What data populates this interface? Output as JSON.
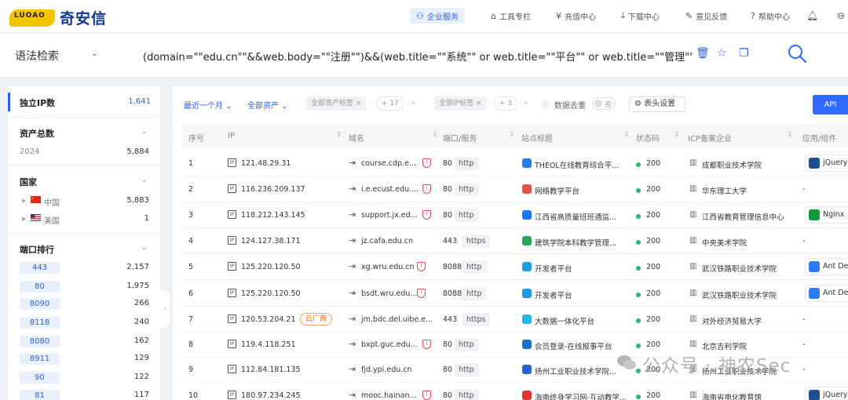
{
  "brand": {
    "logo_mark_text": "LUOAO",
    "name": "奇安信"
  },
  "nav": [
    {
      "label": "企业服务",
      "icon": "user-service-icon",
      "active": true
    },
    {
      "label": "工具专栏",
      "icon": "toolbox-icon"
    },
    {
      "label": "充值中心",
      "icon": "yen-icon"
    },
    {
      "label": "下载中心",
      "icon": "download-icon"
    },
    {
      "label": "意见反馈",
      "icon": "feedback-icon"
    },
    {
      "label": "帮助中心",
      "icon": "help-icon"
    }
  ],
  "search": {
    "mode_label": "语法检索",
    "query": "(domain=\"\"edu.cn\"\"&&web.body=\"\"注册\"\")&&(web.title=\"\"系统\"\" or web.title=\"\"平台\"\" or web.title=\"\"管理\"\" or web.title=\"\"后台\"\")"
  },
  "sidebar": {
    "unique_ip": {
      "label": "独立IP数",
      "value": "1,641"
    },
    "assets": {
      "label": "资产总数",
      "year": "2024",
      "count": "5,884"
    },
    "country": {
      "label": "国家",
      "items": [
        {
          "name": "中国",
          "count": "5,883"
        },
        {
          "name": "美国",
          "count": "1"
        }
      ]
    },
    "ports": {
      "label": "端口排行",
      "items": [
        {
          "port": "443",
          "count": "2,157"
        },
        {
          "port": "80",
          "count": "1,975"
        },
        {
          "port": "8090",
          "count": "266"
        },
        {
          "port": "8118",
          "count": "240"
        },
        {
          "port": "8080",
          "count": "162"
        },
        {
          "port": "8911",
          "count": "129"
        },
        {
          "port": "90",
          "count": "122"
        },
        {
          "port": "81",
          "count": "117"
        }
      ]
    }
  },
  "filters": {
    "time": "最近一个月",
    "assets": "全部资产",
    "asset_tag": "全部资产标签",
    "asset_tag_count": "+ 17",
    "ip_tag": "全部IP标签",
    "ip_tag_count": "+ 3",
    "dedupe_label": "数据去重",
    "dedupe_state": "否",
    "column_settings": "表头设置",
    "api": "API"
  },
  "table": {
    "headers": [
      "序号",
      "IP",
      "域名",
      "端口/服务",
      "站点标题",
      "状态码",
      "ICP备案企业",
      "应用/组件"
    ],
    "rows": [
      {
        "no": "1",
        "ip": "121.48.29.31",
        "domain": "course.cdp.e...",
        "shield": true,
        "port": "80",
        "proto": "http",
        "title": "THEOL在线教育综合平...",
        "icon_color": "#2a7de1",
        "status": "200",
        "icp": "成都职业技术学院",
        "component": "jQuery",
        "comp_color": "#1e4f8f"
      },
      {
        "no": "2",
        "ip": "116.236.209.137",
        "domain": "i.e.ecust.edu....",
        "shield": true,
        "port": "80",
        "proto": "http",
        "title": "网络教学平台",
        "icon_color": "#e2574c",
        "status": "200",
        "icp": "华东理工大学",
        "component": "-"
      },
      {
        "no": "3",
        "ip": "118.212.143.145",
        "domain": "support.jx.ed...",
        "shield": true,
        "port": "80",
        "proto": "http",
        "title": "江西省高质量班班通监...",
        "icon_color": "#1677ff",
        "status": "200",
        "icp": "江西省教育管理信息中心",
        "component": "Nginx",
        "comp_color": "#119a3c"
      },
      {
        "no": "4",
        "ip": "124.127.38.171",
        "domain": "jz.cafa.edu.cn",
        "shield": false,
        "port": "443",
        "proto": "https",
        "title": "建筑学院本科教学管理...",
        "icon_color": "#2aa65a",
        "status": "200",
        "icp": "中央美术学院",
        "component": "-"
      },
      {
        "no": "5",
        "ip": "125.220.120.50",
        "domain": "xg.wru.edu.cn",
        "shield": true,
        "port": "8088",
        "proto": "http",
        "title": "开发者平台",
        "icon_color": "#1f9bdc",
        "status": "200",
        "icp": "武汉铁路职业技术学院",
        "component": "Ant Des",
        "comp_color": "#2f7af5"
      },
      {
        "no": "6",
        "ip": "125.220.120.50",
        "domain": "bsdt.wru.edu...",
        "shield": true,
        "port": "8088",
        "proto": "http",
        "title": "开发者平台",
        "icon_color": "#1f9bdc",
        "status": "200",
        "icp": "武汉铁路职业技术学院",
        "component": "Ant Des",
        "comp_color": "#2f7af5"
      },
      {
        "no": "7",
        "ip": "120.53.204.21",
        "cloud": "云厂商",
        "domain": "jm.bdc.del.uibe.e...",
        "shield": false,
        "port": "443",
        "proto": "https",
        "title": "大数据一体化平台",
        "icon_color": "#2bb5e8",
        "status": "200",
        "icp": "对外经济贸易大学",
        "component": "-"
      },
      {
        "no": "8",
        "ip": "119.4.118.251",
        "domain": "bxpt.guc.edu...",
        "shield": true,
        "port": "80",
        "proto": "http",
        "title": "会员登录-在线报事平台",
        "icon_color": "#1a73c9",
        "status": "200",
        "icp": "北京吉利学院",
        "component": "-"
      },
      {
        "no": "9",
        "ip": "112.84.181.135",
        "domain": "fjd.ypi.edu.cn",
        "shield": false,
        "port": "80",
        "proto": "http",
        "title": "扬州工业职业技术学院...",
        "icon_color": "#2a64c9",
        "status": "200",
        "icp": "扬州工业职业技术学院",
        "component": "-"
      },
      {
        "no": "10",
        "ip": "180.97.234.245",
        "domain": "mooc.hainan...",
        "shield": true,
        "port": "80",
        "proto": "http",
        "title": "海南终身学习网-互动教学...",
        "icon_color": "#d33",
        "status": "200",
        "icp": "海南省电化教育馆",
        "component": "jQuery/...",
        "comp_color": "#1e4f8f"
      }
    ]
  },
  "watermark": "公众号 · 神农Sec"
}
